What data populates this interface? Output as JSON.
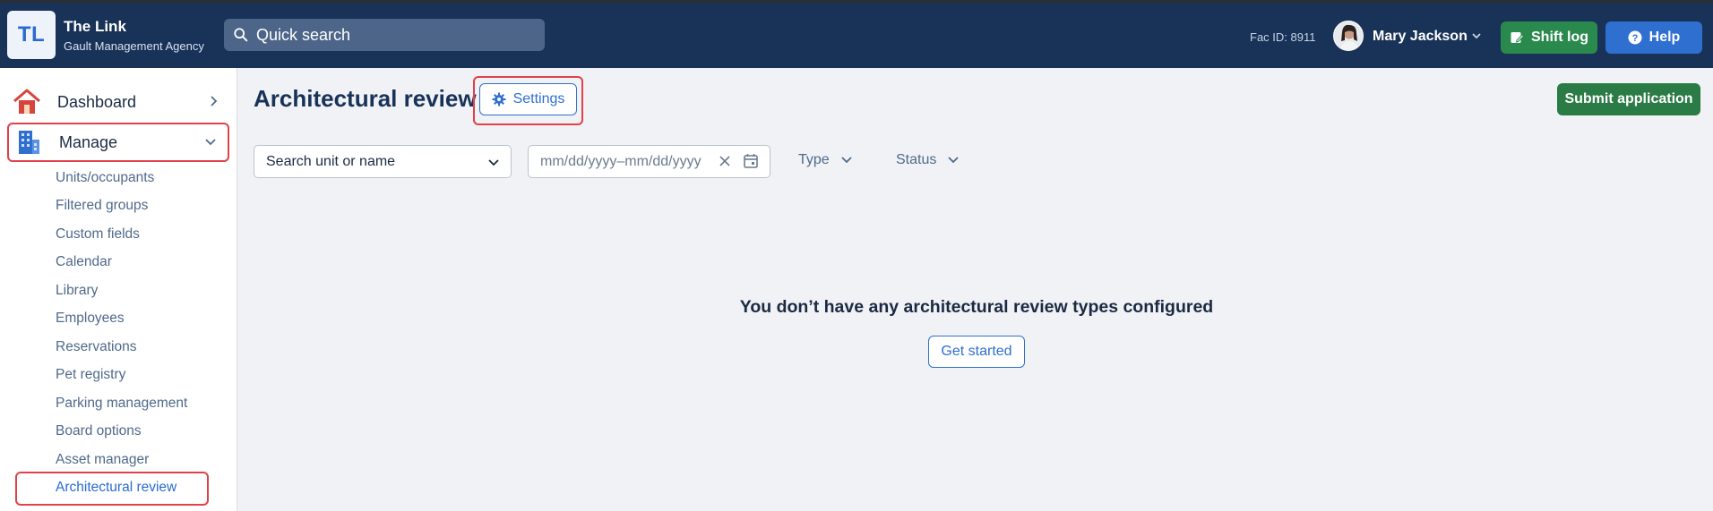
{
  "header": {
    "logo_initials": "TL",
    "org_name": "The Link",
    "org_subtitle": "Gault Management Agency",
    "quick_search_label": "Quick search",
    "fac_id": "Fac ID: 8911",
    "user_name": "Mary Jackson",
    "shift_log_label": "Shift log",
    "help_label": "Help"
  },
  "sidebar": {
    "dashboard_label": "Dashboard",
    "manage_label": "Manage",
    "items": [
      {
        "label": "Units/occupants"
      },
      {
        "label": "Filtered groups"
      },
      {
        "label": "Custom fields"
      },
      {
        "label": "Calendar"
      },
      {
        "label": "Library"
      },
      {
        "label": "Employees"
      },
      {
        "label": "Reservations"
      },
      {
        "label": "Pet registry"
      },
      {
        "label": "Parking management"
      },
      {
        "label": "Board options"
      },
      {
        "label": "Asset manager"
      },
      {
        "label": "Architectural review"
      }
    ],
    "active_item": "Architectural review"
  },
  "main": {
    "title": "Architectural review",
    "settings_label": "Settings",
    "submit_label": "Submit application",
    "filters": {
      "search_label": "Search unit or name",
      "date_placeholder": "mm/dd/yyyy–mm/dd/yyyy",
      "type_label": "Type",
      "status_label": "Status"
    },
    "empty_message": "You don’t have any architectural review types configured",
    "get_started_label": "Get started"
  },
  "colors": {
    "header_bg": "#183258",
    "accent_blue": "#2f6fd0",
    "green": "#2a8a4e",
    "highlight_red": "#e0414a"
  }
}
